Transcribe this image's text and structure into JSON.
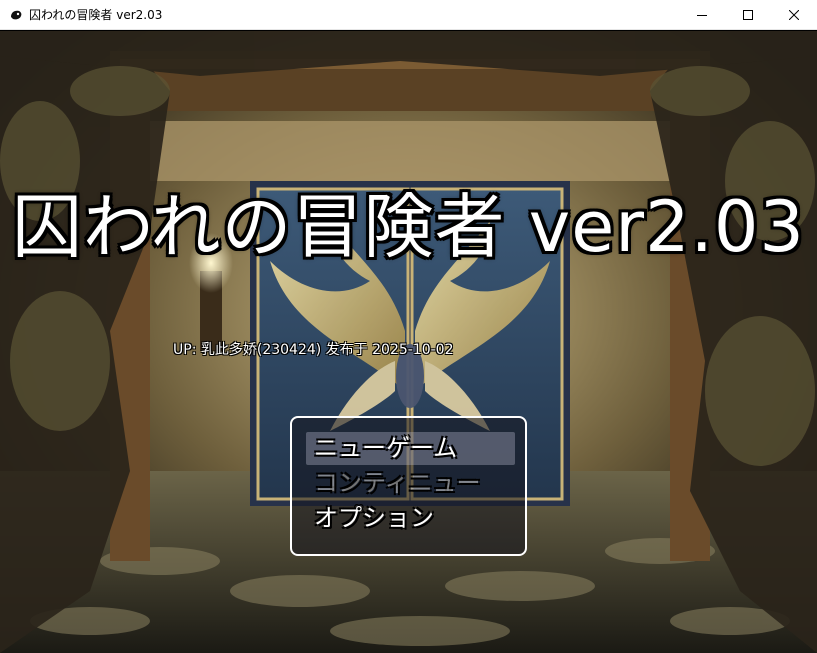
{
  "window": {
    "title": "囚われの冒険者 ver2.03",
    "icon": "app-icon",
    "controls": [
      "minimize-icon",
      "maximize-icon",
      "close-icon"
    ]
  },
  "game": {
    "title": "囚われの冒険者 ver2.03",
    "credit": "UP: 乳此多娇(230424) 发布于 2025-10-02"
  },
  "menu": {
    "items": [
      {
        "label": "ニューゲーム",
        "state": "selected"
      },
      {
        "label": "コンティニュー",
        "state": "disabled"
      },
      {
        "label": "オプション",
        "state": "enabled"
      }
    ]
  }
}
